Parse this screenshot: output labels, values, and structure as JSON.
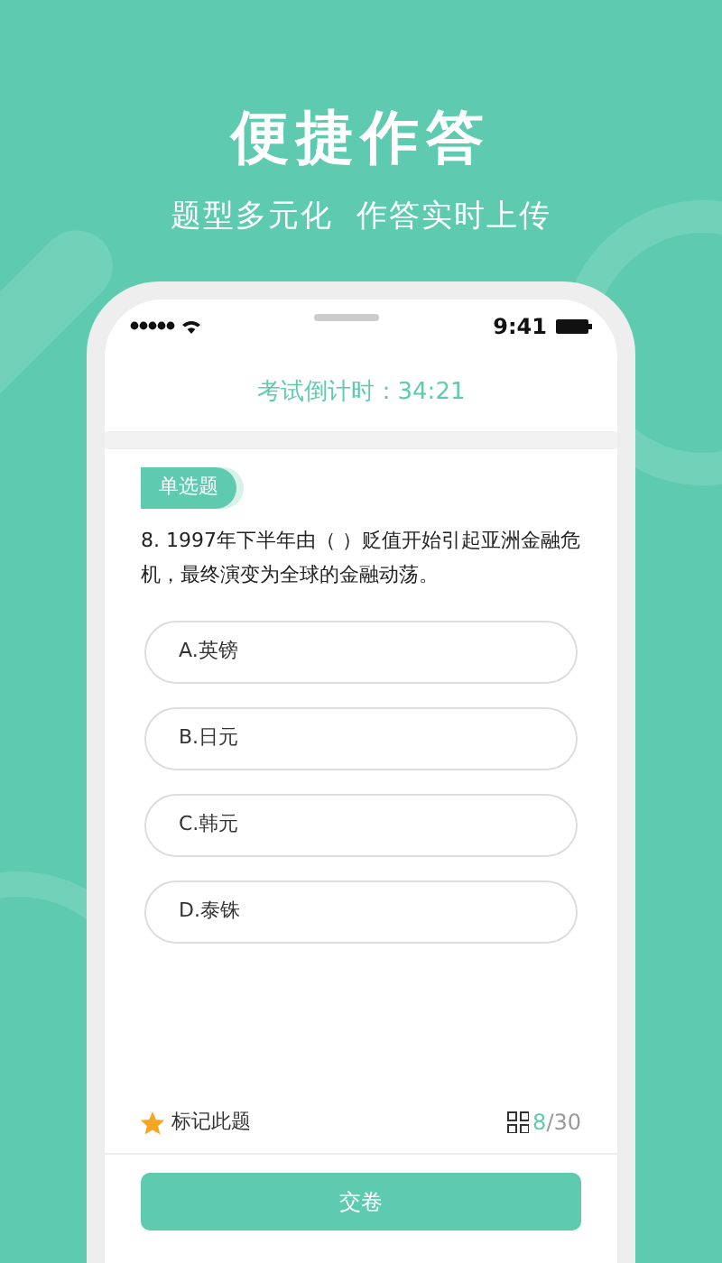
{
  "headline": "便捷作答",
  "subheadline": "题型多元化  作答实时上传",
  "status_bar": {
    "time": "9:41"
  },
  "timer": {
    "label": "考试倒计时：",
    "value": "34:21"
  },
  "question": {
    "type_tag": "单选题",
    "text": "8. 1997年下半年由（ ）贬值开始引起亚洲金融危机，最终演变为全球的金融动荡。",
    "options": [
      {
        "label": "A.英镑",
        "selected": false
      },
      {
        "label": "B.日元",
        "selected": false
      },
      {
        "label": "C.韩元",
        "selected": false
      },
      {
        "label": "D.泰铢",
        "selected": false
      }
    ]
  },
  "footer": {
    "mark_label": "标记此题",
    "marked": true,
    "progress_current": "8",
    "progress_total": "/30",
    "submit": "交卷"
  }
}
